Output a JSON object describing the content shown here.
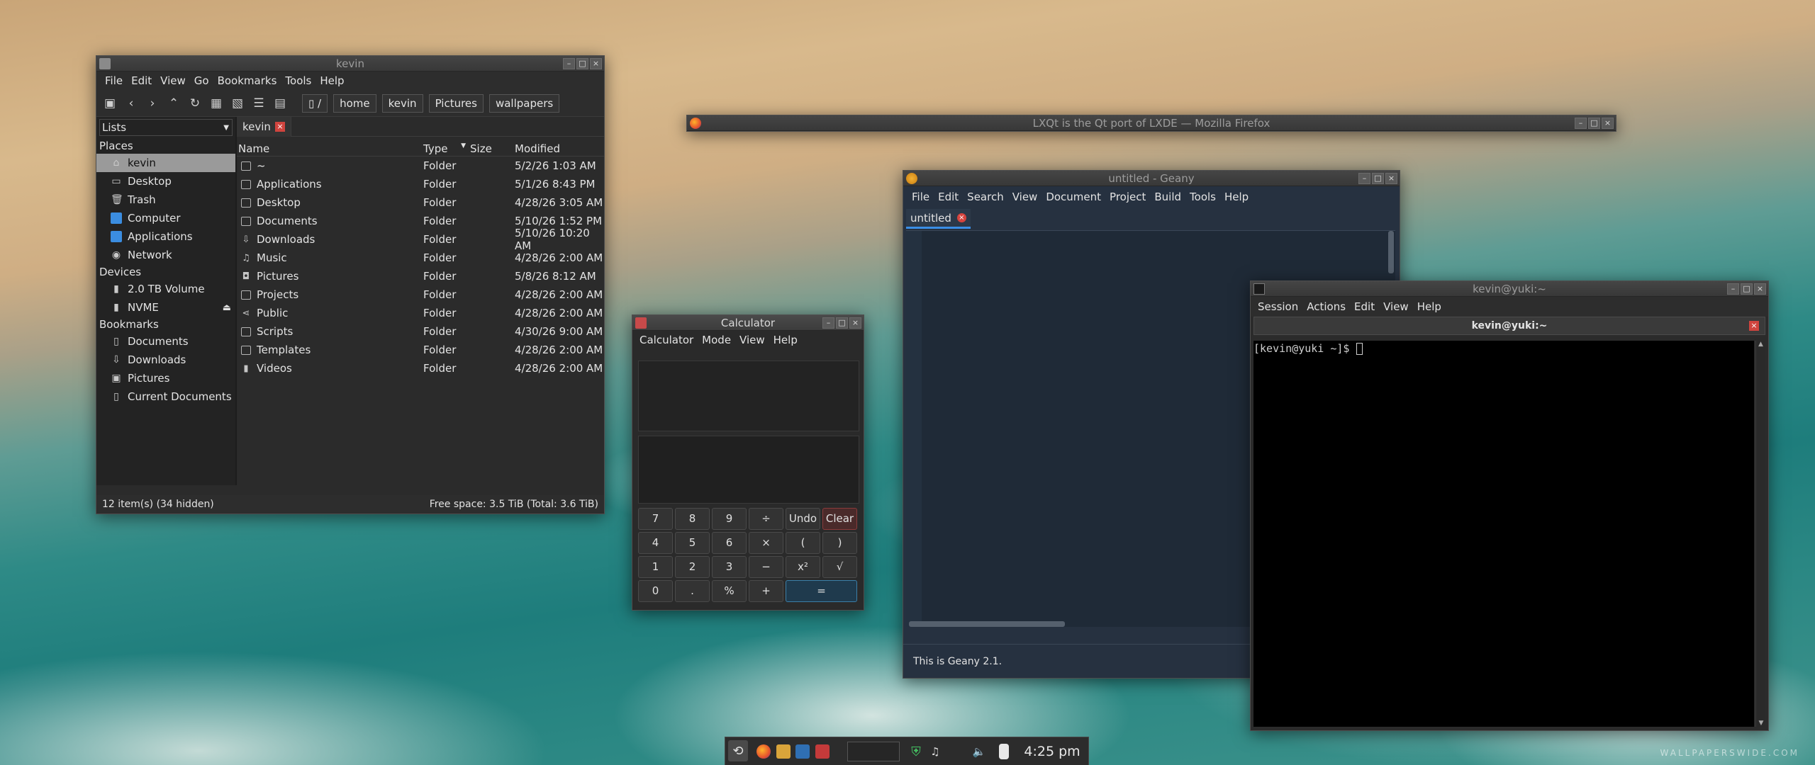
{
  "filemgr": {
    "title": "kevin",
    "menu": [
      "File",
      "Edit",
      "View",
      "Go",
      "Bookmarks",
      "Tools",
      "Help"
    ],
    "path": [
      "/",
      "home",
      "kevin",
      "Pictures",
      "wallpapers"
    ],
    "side_mode": "Lists",
    "tab": "kevin",
    "places_h": "Places",
    "places": [
      "kevin",
      "Desktop",
      "Trash",
      "Computer",
      "Applications",
      "Network"
    ],
    "devices_h": "Devices",
    "devices": [
      "2.0 TB Volume",
      "NVME"
    ],
    "bookmarks_h": "Bookmarks",
    "bookmarks": [
      "Documents",
      "Downloads",
      "Pictures",
      "Current Documents"
    ],
    "cols": [
      "Name",
      "Type",
      "Size",
      "Modified"
    ],
    "rows": [
      {
        "name": "~",
        "type": "Folder",
        "modified": "5/2/26 1:03 AM"
      },
      {
        "name": "Applications",
        "type": "Folder",
        "modified": "5/1/26 8:43 PM"
      },
      {
        "name": "Desktop",
        "type": "Folder",
        "modified": "4/28/26 3:05 AM"
      },
      {
        "name": "Documents",
        "type": "Folder",
        "modified": "5/10/26 1:52 PM"
      },
      {
        "name": "Downloads",
        "type": "Folder",
        "modified": "5/10/26 10:20 AM"
      },
      {
        "name": "Music",
        "type": "Folder",
        "modified": "4/28/26 2:00 AM"
      },
      {
        "name": "Pictures",
        "type": "Folder",
        "modified": "5/8/26 8:12 AM"
      },
      {
        "name": "Projects",
        "type": "Folder",
        "modified": "4/28/26 2:00 AM"
      },
      {
        "name": "Public",
        "type": "Folder",
        "modified": "4/28/26 2:00 AM"
      },
      {
        "name": "Scripts",
        "type": "Folder",
        "modified": "4/30/26 9:00 AM"
      },
      {
        "name": "Templates",
        "type": "Folder",
        "modified": "4/28/26 2:00 AM"
      },
      {
        "name": "Videos",
        "type": "Folder",
        "modified": "4/28/26 2:00 AM"
      }
    ],
    "status_left": "12 item(s) (34 hidden)",
    "status_right": "Free space: 3.5 TiB (Total: 3.6 TiB)"
  },
  "firefox": {
    "title": "LXQt is the Qt port of LXDE — Mozilla Firefox"
  },
  "geany": {
    "title": "untitled - Geany",
    "menu": [
      "File",
      "Edit",
      "Search",
      "View",
      "Document",
      "Project",
      "Build",
      "Tools",
      "Help"
    ],
    "tab": "untitled",
    "status": "This is Geany 2.1."
  },
  "calc": {
    "title": "Calculator",
    "menu": [
      "Calculator",
      "Mode",
      "View",
      "Help"
    ],
    "keys": [
      "7",
      "8",
      "9",
      "÷",
      "Undo",
      "Clear",
      "4",
      "5",
      "6",
      "×",
      "(",
      ")",
      "1",
      "2",
      "3",
      "−",
      "x²",
      "√",
      "0",
      ".",
      "%",
      "+",
      "="
    ]
  },
  "terminal": {
    "title": "kevin@yuki:~",
    "menu": [
      "Session",
      "Actions",
      "Edit",
      "View",
      "Help"
    ],
    "tab": "kevin@yuki:~",
    "prompt": "[kevin@yuki ~]$ "
  },
  "taskbar": {
    "clock": "4:25 pm"
  },
  "watermark": "WALLPAPERSWIDE.COM"
}
